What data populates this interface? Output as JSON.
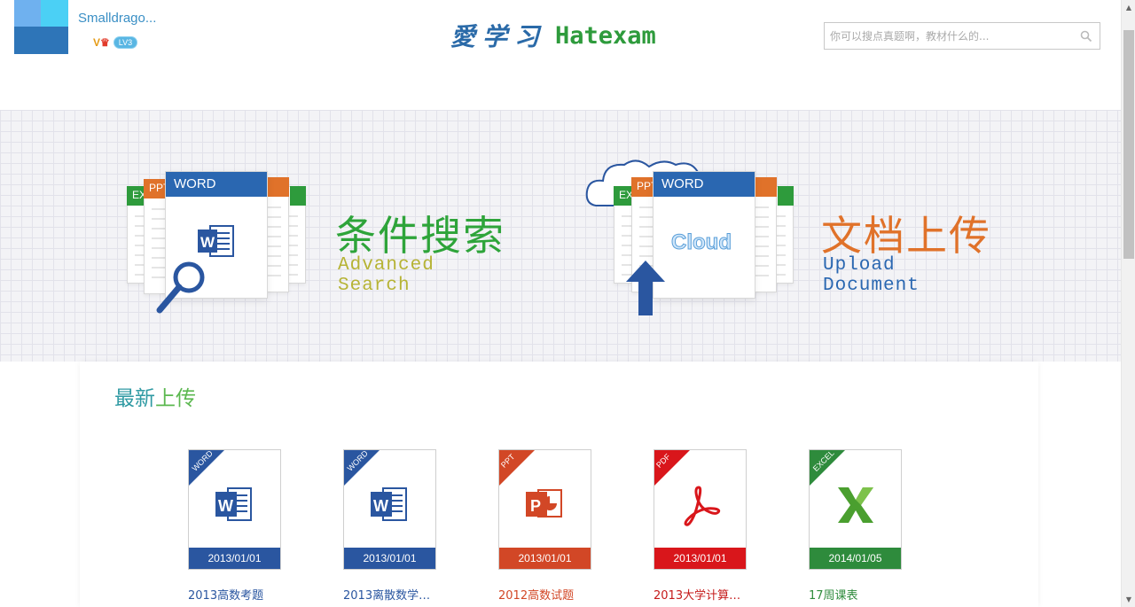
{
  "user": {
    "name": "Smalldrago...",
    "vip_badge": "V",
    "level_badge": "LV3"
  },
  "brand": {
    "cn": "愛学习",
    "en": "Hatexam"
  },
  "search": {
    "placeholder": "你可以搜点真题啊，教材什么的..."
  },
  "banner": {
    "search_feature": {
      "title": "条件搜索",
      "subtitle": "Advanced Search",
      "title_color": "#2ea43a",
      "subtitle_color": "#b6b335",
      "tabs": [
        "EXCEL",
        "PPT",
        "WORD"
      ]
    },
    "upload_feature": {
      "title": "文档上传",
      "subtitle": "Upload Document",
      "title_color": "#e0722a",
      "subtitle_color": "#2a67b1",
      "tabs": [
        "EXCEL",
        "PPT",
        "WORD"
      ],
      "cloud_text": "Cloud"
    }
  },
  "latest": {
    "title_part1": "最新",
    "title_part2": "上传",
    "files": [
      {
        "type": "WORD",
        "date": "2013/01/01",
        "name": "2013高数考题",
        "color": "#2a56a0",
        "name_color": "#2a56a0",
        "icon": "word-icon"
      },
      {
        "type": "WORD",
        "date": "2013/01/01",
        "name": "2013离散数学…",
        "color": "#2a56a0",
        "name_color": "#2a56a0",
        "icon": "word-icon"
      },
      {
        "type": "PPT",
        "date": "2013/01/01",
        "name": "2012高数试题",
        "color": "#d24726",
        "name_color": "#d24726",
        "icon": "powerpoint-icon"
      },
      {
        "type": "PDF",
        "date": "2013/01/01",
        "name": "2013大学计算…",
        "color": "#d9161b",
        "name_color": "#c51a1a",
        "icon": "acrobat-icon"
      },
      {
        "type": "EXCEL",
        "date": "2014/01/05",
        "name": "17周课表",
        "color": "#2e8b3c",
        "name_color": "#2e8b3c",
        "icon": "excel-icon"
      }
    ]
  }
}
